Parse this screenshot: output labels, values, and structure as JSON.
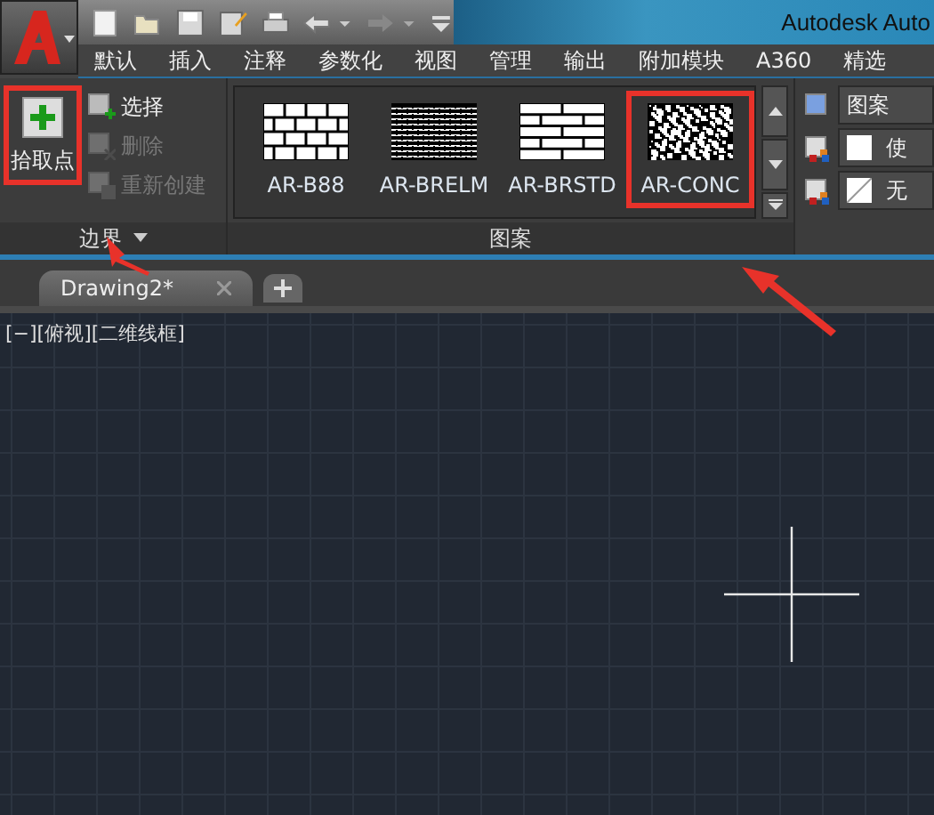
{
  "title_bar": {
    "title": "Autodesk Auto"
  },
  "ribbon_tabs": [
    {
      "label": "默认"
    },
    {
      "label": "插入"
    },
    {
      "label": "注释"
    },
    {
      "label": "参数化"
    },
    {
      "label": "视图"
    },
    {
      "label": "管理"
    },
    {
      "label": "输出"
    },
    {
      "label": "附加模块"
    },
    {
      "label": "A360"
    },
    {
      "label": "精选"
    }
  ],
  "boundary_panel": {
    "title": "边界",
    "pick_button": {
      "label": "拾取点",
      "highlighted": true
    },
    "tools": [
      {
        "label": "选择",
        "disabled": false,
        "kind": "select"
      },
      {
        "label": "删除",
        "disabled": true,
        "kind": "delete"
      },
      {
        "label": "重新创建",
        "disabled": true,
        "kind": "recreate"
      }
    ]
  },
  "pattern_panel": {
    "title": "图案",
    "patterns": [
      {
        "name": "AR-B88",
        "kind": "brick",
        "highlighted": false
      },
      {
        "name": "AR-BRELM",
        "kind": "fine-brick",
        "highlighted": false
      },
      {
        "name": "AR-BRSTD",
        "kind": "running-brick",
        "highlighted": false
      },
      {
        "name": "AR-CONC",
        "kind": "concrete",
        "highlighted": true
      }
    ]
  },
  "properties_panel": {
    "rows": [
      {
        "label": "图案",
        "kind": "dropdown"
      },
      {
        "label": "使",
        "kind": "color"
      },
      {
        "label": "无",
        "kind": "none"
      }
    ]
  },
  "file_tabs": [
    {
      "label": "Drawing2*"
    }
  ],
  "viewport": {
    "label": "[−][俯视][二维线框]"
  }
}
